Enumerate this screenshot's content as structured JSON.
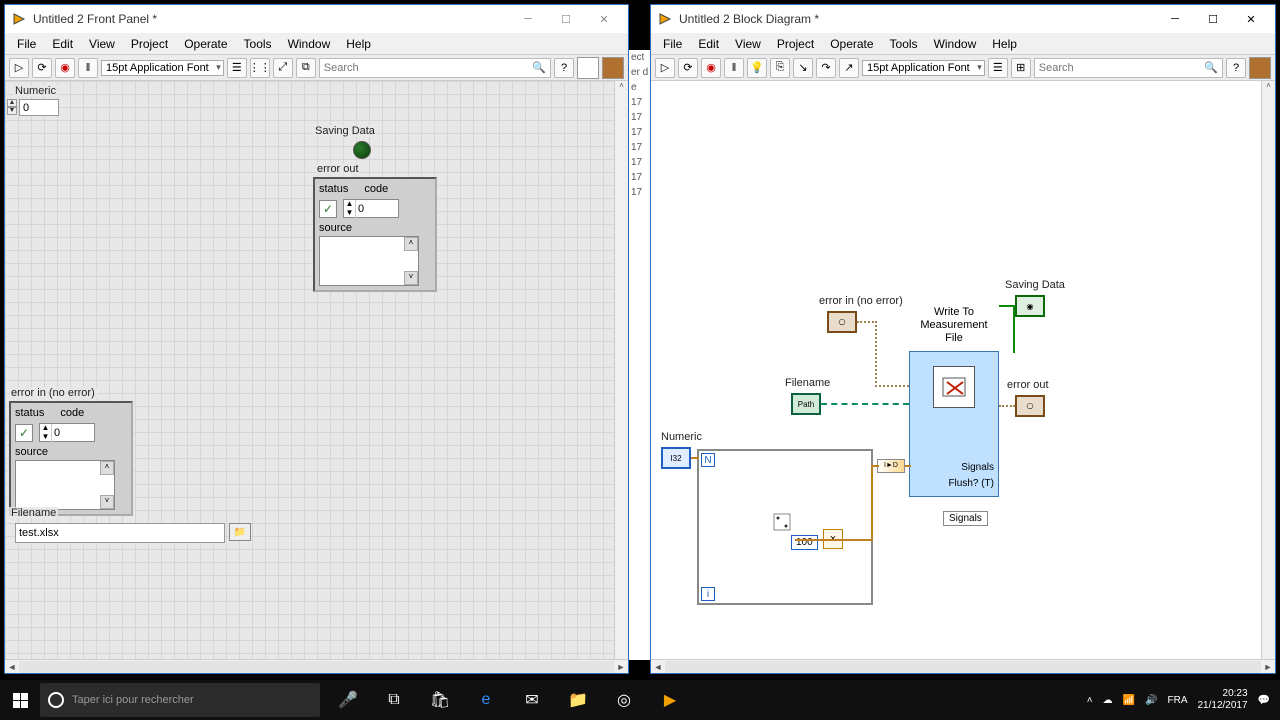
{
  "fp_window": {
    "title": "Untitled 2 Front Panel *",
    "menus": [
      "File",
      "Edit",
      "View",
      "Project",
      "Operate",
      "Tools",
      "Window",
      "Help"
    ],
    "font": "15pt Application Font",
    "search_placeholder": "Search",
    "numeric_label": "Numeric",
    "numeric_value": "0",
    "saving_label": "Saving Data",
    "error_out_label": "error out",
    "error_in_label": "error in (no error)",
    "status_label": "status",
    "code_label": "code",
    "code_value": "0",
    "source_label": "source",
    "filename_label": "Filename",
    "filename_value": "test.xlsx"
  },
  "bd_window": {
    "title": "Untitled 2 Block Diagram *",
    "menus": [
      "File",
      "Edit",
      "View",
      "Project",
      "Operate",
      "Tools",
      "Window",
      "Help"
    ],
    "font": "15pt Application Font",
    "search_placeholder": "Search",
    "error_in_label": "error in (no error)",
    "filename_label": "Filename",
    "numeric_label": "Numeric",
    "express_label": "Write To\nMeasurement\nFile",
    "saving_label": "Saving Data",
    "error_out_label": "error out",
    "signals_label": "Signals",
    "flush_label": "Flush? (T)",
    "signals_tag": "Signals",
    "loop_n": "N",
    "loop_i": "i",
    "const_val": "100",
    "conv_lbl": "I►D"
  },
  "partial_rows": [
    "ect",
    "er d",
    "e",
    "17",
    "17",
    "17",
    "17",
    "17",
    "17",
    "17"
  ],
  "taskbar": {
    "search_placeholder": "Taper ici pour rechercher",
    "time": "20:23",
    "date": "21/12/2017"
  }
}
